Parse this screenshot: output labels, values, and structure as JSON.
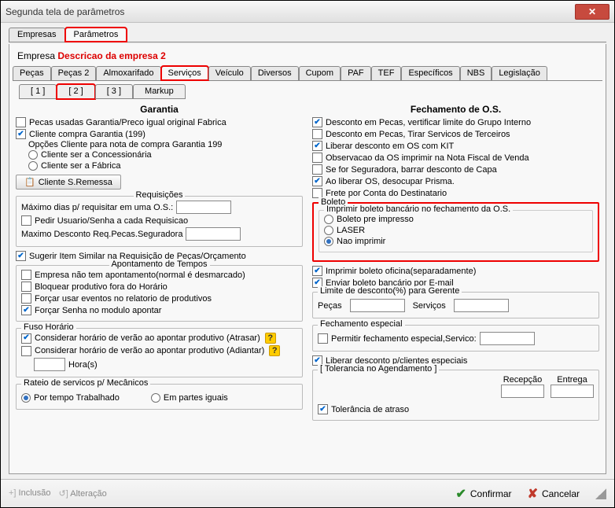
{
  "window": {
    "title": "Segunda tela de parâmetros"
  },
  "topTabs": {
    "empresas": "Empresas",
    "parametros": "Parâmetros"
  },
  "empresa": {
    "label": "Empresa",
    "value": "Descricao da empresa 2"
  },
  "tabs2": {
    "pecas": "Peças",
    "pecas2": "Peças 2",
    "almox": "Almoxarifado",
    "servicos": "Serviços",
    "veiculo": "Veículo",
    "diversos": "Diversos",
    "cupom": "Cupom",
    "paf": "PAF",
    "tef": "TEF",
    "espec": "Específicos",
    "nbs": "NBS",
    "legis": "Legislação"
  },
  "tabs3": {
    "t1": "[ 1 ]",
    "t2": "[ 2 ]",
    "t3": "[ 3 ]",
    "markup": "Markup"
  },
  "left": {
    "garantia": {
      "title": "Garantia",
      "pecasUsadas": "Pecas usadas Garantia/Preco igual original Fabrica",
      "clienteCompra": "Cliente compra Garantia (199)",
      "opcoesCliente": "Opções Cliente para nota de compra Garantia 199",
      "concess": "Cliente ser a Concessionária",
      "fabrica": "Cliente ser a Fábrica",
      "btnSRemessa": "Cliente S.Remessa"
    },
    "req": {
      "title": "Requisições",
      "maxDias": "Máximo dias p/ requisitar em uma O.S.:",
      "pedirUsuario": "Pedir Usuario/Senha a cada Requisicao",
      "maxDesc": "Maximo Desconto Req.Pecas.Seguradora",
      "sugerir": "Sugerir Item Similar na Requisição de Peças/Orçamento"
    },
    "apont": {
      "title": "Apontamento de Tempos",
      "semApont": "Empresa não tem apontamento(normal é desmarcado)",
      "bloquear": "Bloquear produtivo fora do Horário",
      "forcarEventos": "Forçar usar eventos no relatorio de produtivos",
      "forcarSenha": "Forçar Senha no modulo apontar"
    },
    "fuso": {
      "title": "Fuso Horário",
      "atrasar": "Considerar horário de verão ao apontar produtivo (Atrasar)",
      "adiantar": "Considerar horário de verão ao apontar produtivo (Adiantar)",
      "horas": "Hora(s)"
    },
    "rateio": {
      "title": "Rateio de servicos p/ Mecânicos",
      "tempo": "Por tempo Trabalhado",
      "partes": "Em partes iguais"
    }
  },
  "right": {
    "fech": {
      "title": "Fechamento de O.S.",
      "descPecasGrupo": "Desconto em Pecas, vertificar limite do Grupo Interno",
      "descPecasTerc": "Desconto em Pecas, Tirar Servicos de Terceiros",
      "liberarKit": "Liberar desconto em OS com KIT",
      "obsOS": "Observacao da OS imprimir na Nota Fiscal de Venda",
      "seguradora": "Se for Seguradora, barrar desconto de Capa",
      "liberarPrisma": "Ao liberar OS, desocupar Prisma.",
      "freteDest": "Frete por Conta do Destinatario"
    },
    "boleto": {
      "title": "Boleto",
      "imprimirTitle": "Imprimir boleto bancário no fechamento da O.S.",
      "preimpresso": "Boleto pre impresso",
      "laser": "LASER",
      "naoimprimir": "Nao imprimir",
      "oficina": "Imprimir boleto oficina(separadamente)",
      "email": "Enviar boleto bancário por E-mail"
    },
    "limite": {
      "title": "Limite de desconto(%) para Gerente",
      "pecas": "Peças",
      "servicos": "Serviços"
    },
    "fechEsp": {
      "title": "Fechamento especial",
      "permitir": "Permitir fechamento especial,Servico:"
    },
    "liberarClientes": "Liberar desconto p/clientes especiais",
    "tol": {
      "title": "[ Tolerancia no Agendamento ]",
      "recepcao": "Recepção",
      "entrega": "Entrega",
      "atraso": "Tolerância de atraso"
    }
  },
  "footer": {
    "inclusao": "Inclusão",
    "alteracao": "Alteração",
    "confirmar": "Confirmar",
    "cancelar": "Cancelar"
  }
}
